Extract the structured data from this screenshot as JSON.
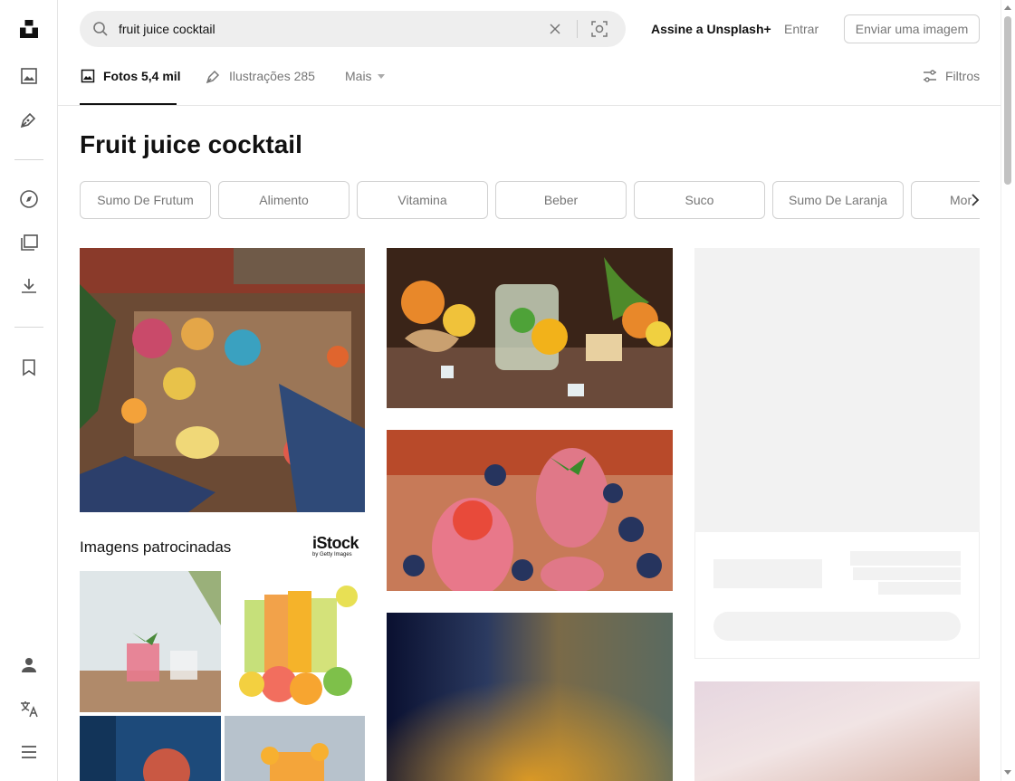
{
  "search": {
    "value": "fruit juice cocktail"
  },
  "header": {
    "plus_label": "Assine a Unsplash+",
    "login_label": "Entrar",
    "upload_label": "Enviar uma imagem"
  },
  "tabs": [
    {
      "label": "Fotos 5,4 mil",
      "icon": "photo-icon"
    },
    {
      "label": "Ilustrações 285",
      "icon": "pen-icon"
    },
    {
      "label": "Mais",
      "icon": "chevron-down-icon"
    }
  ],
  "filters_label": "Filtros",
  "page_title": "Fruit juice cocktail",
  "related": [
    "Sumo De Frutum",
    "Alimento",
    "Vitamina",
    "Beber",
    "Suco",
    "Sumo De Laranja",
    "Mor"
  ],
  "sponsored": {
    "title": "Imagens patrocinadas",
    "brand": "iStock",
    "brand_sub": "by Getty Images"
  },
  "sidebar": {
    "icons": [
      "unsplash-logo",
      "photos-icon",
      "illustrations-icon",
      "explore-icon",
      "collections-icon",
      "downloads-icon",
      "bookmark-icon",
      "account-icon",
      "language-icon",
      "menu-icon"
    ]
  },
  "colors": {
    "accent": "#111111",
    "muted": "#767676",
    "border": "#d1d1d1",
    "search_bg": "#eeeeee"
  }
}
